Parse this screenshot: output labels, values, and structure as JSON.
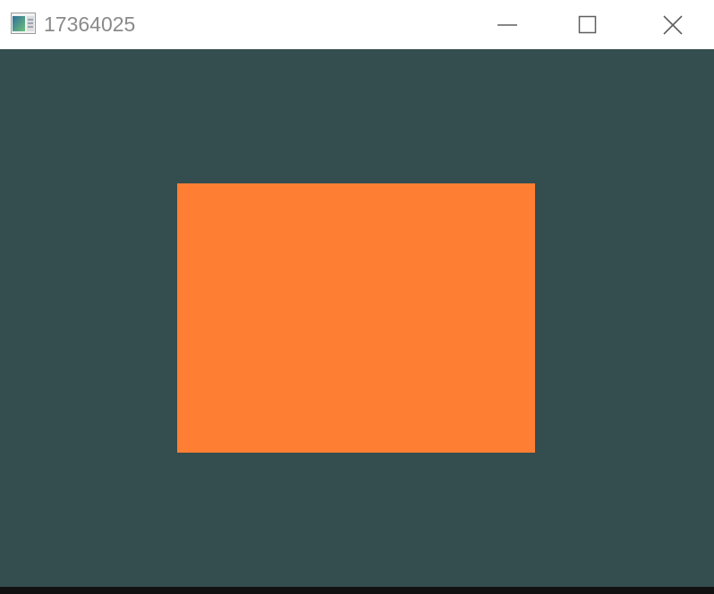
{
  "window": {
    "title": "17364025",
    "app_icon": "app-window-icon",
    "controls": {
      "minimize_icon": "minimize-icon",
      "maximize_icon": "maximize-icon",
      "close_icon": "close-icon"
    }
  },
  "canvas": {
    "clear_color": "#344d4e",
    "quad_color": "#fe7f33"
  },
  "colors": {
    "titlebar_bg": "#ffffff",
    "title_text": "#8a8a8a",
    "control_glyph": "#5f5f5f",
    "bottom_edge": "#111111"
  }
}
